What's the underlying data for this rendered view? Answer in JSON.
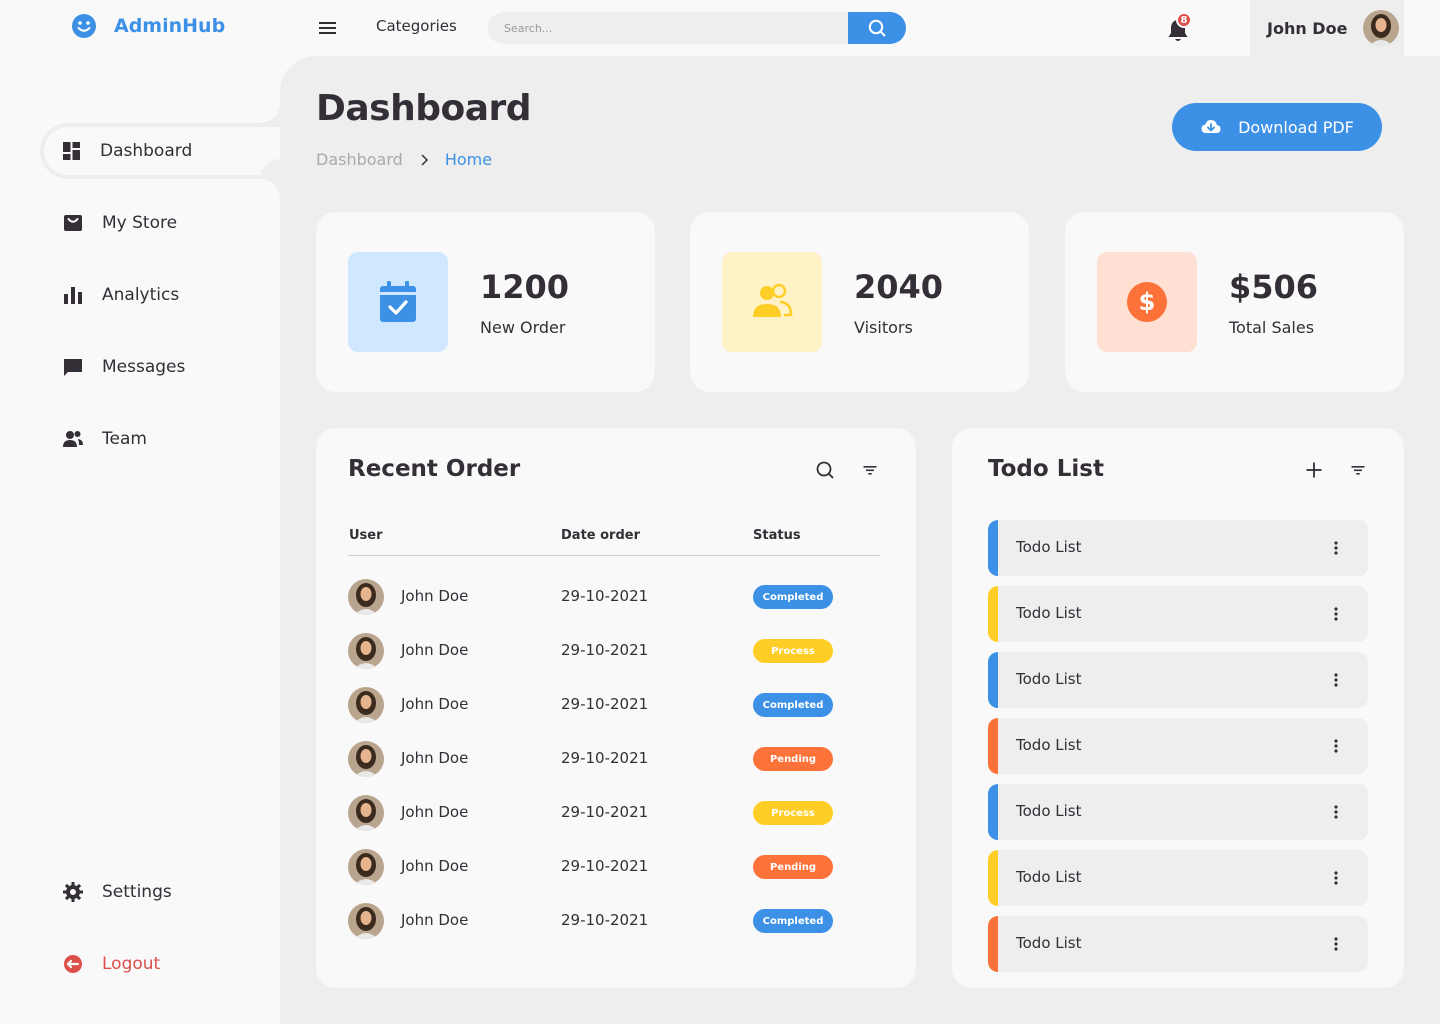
{
  "brand": {
    "name": "AdminHub"
  },
  "topbar": {
    "categories": "Categories",
    "search_placeholder": "Search...",
    "notification_count": "8",
    "user_name": "John Doe"
  },
  "sidebar": {
    "items": [
      {
        "label": "Dashboard"
      },
      {
        "label": "My Store"
      },
      {
        "label": "Analytics"
      },
      {
        "label": "Messages"
      },
      {
        "label": "Team"
      }
    ],
    "settings": "Settings",
    "logout": "Logout"
  },
  "header": {
    "title": "Dashboard",
    "breadcrumb": [
      "Dashboard",
      "Home"
    ],
    "download_label": "Download PDF"
  },
  "stats": [
    {
      "value": "1200",
      "label": "New Order",
      "icon": "calendar-check-icon"
    },
    {
      "value": "2040",
      "label": "Visitors",
      "icon": "people-icon"
    },
    {
      "value": "$506",
      "label": "Total Sales",
      "icon": "dollar-circle-icon"
    }
  ],
  "orders": {
    "title": "Recent Order",
    "columns": [
      "User",
      "Date order",
      "Status"
    ],
    "rows": [
      {
        "user": "John Doe",
        "date": "29-10-2021",
        "status": "Completed"
      },
      {
        "user": "John Doe",
        "date": "29-10-2021",
        "status": "Process"
      },
      {
        "user": "John Doe",
        "date": "29-10-2021",
        "status": "Completed"
      },
      {
        "user": "John Doe",
        "date": "29-10-2021",
        "status": "Pending"
      },
      {
        "user": "John Doe",
        "date": "29-10-2021",
        "status": "Process"
      },
      {
        "user": "John Doe",
        "date": "29-10-2021",
        "status": "Pending"
      },
      {
        "user": "John Doe",
        "date": "29-10-2021",
        "status": "Completed"
      }
    ]
  },
  "todo": {
    "title": "Todo List",
    "items": [
      {
        "label": "Todo List",
        "color": "#3c91e6"
      },
      {
        "label": "Todo List",
        "color": "#ffce26"
      },
      {
        "label": "Todo List",
        "color": "#3c91e6"
      },
      {
        "label": "Todo List",
        "color": "#fd7238"
      },
      {
        "label": "Todo List",
        "color": "#3c91e6"
      },
      {
        "label": "Todo List",
        "color": "#ffce26"
      },
      {
        "label": "Todo List",
        "color": "#fd7238"
      }
    ]
  },
  "colors": {
    "blue": "#3c91e6",
    "yellow": "#ffce26",
    "orange": "#fd7238",
    "red": "#db504a",
    "dark": "#342e37",
    "light_blue": "#cfe8ff",
    "light_yellow": "#fff2c6",
    "light_orange": "#ffe0d3"
  }
}
